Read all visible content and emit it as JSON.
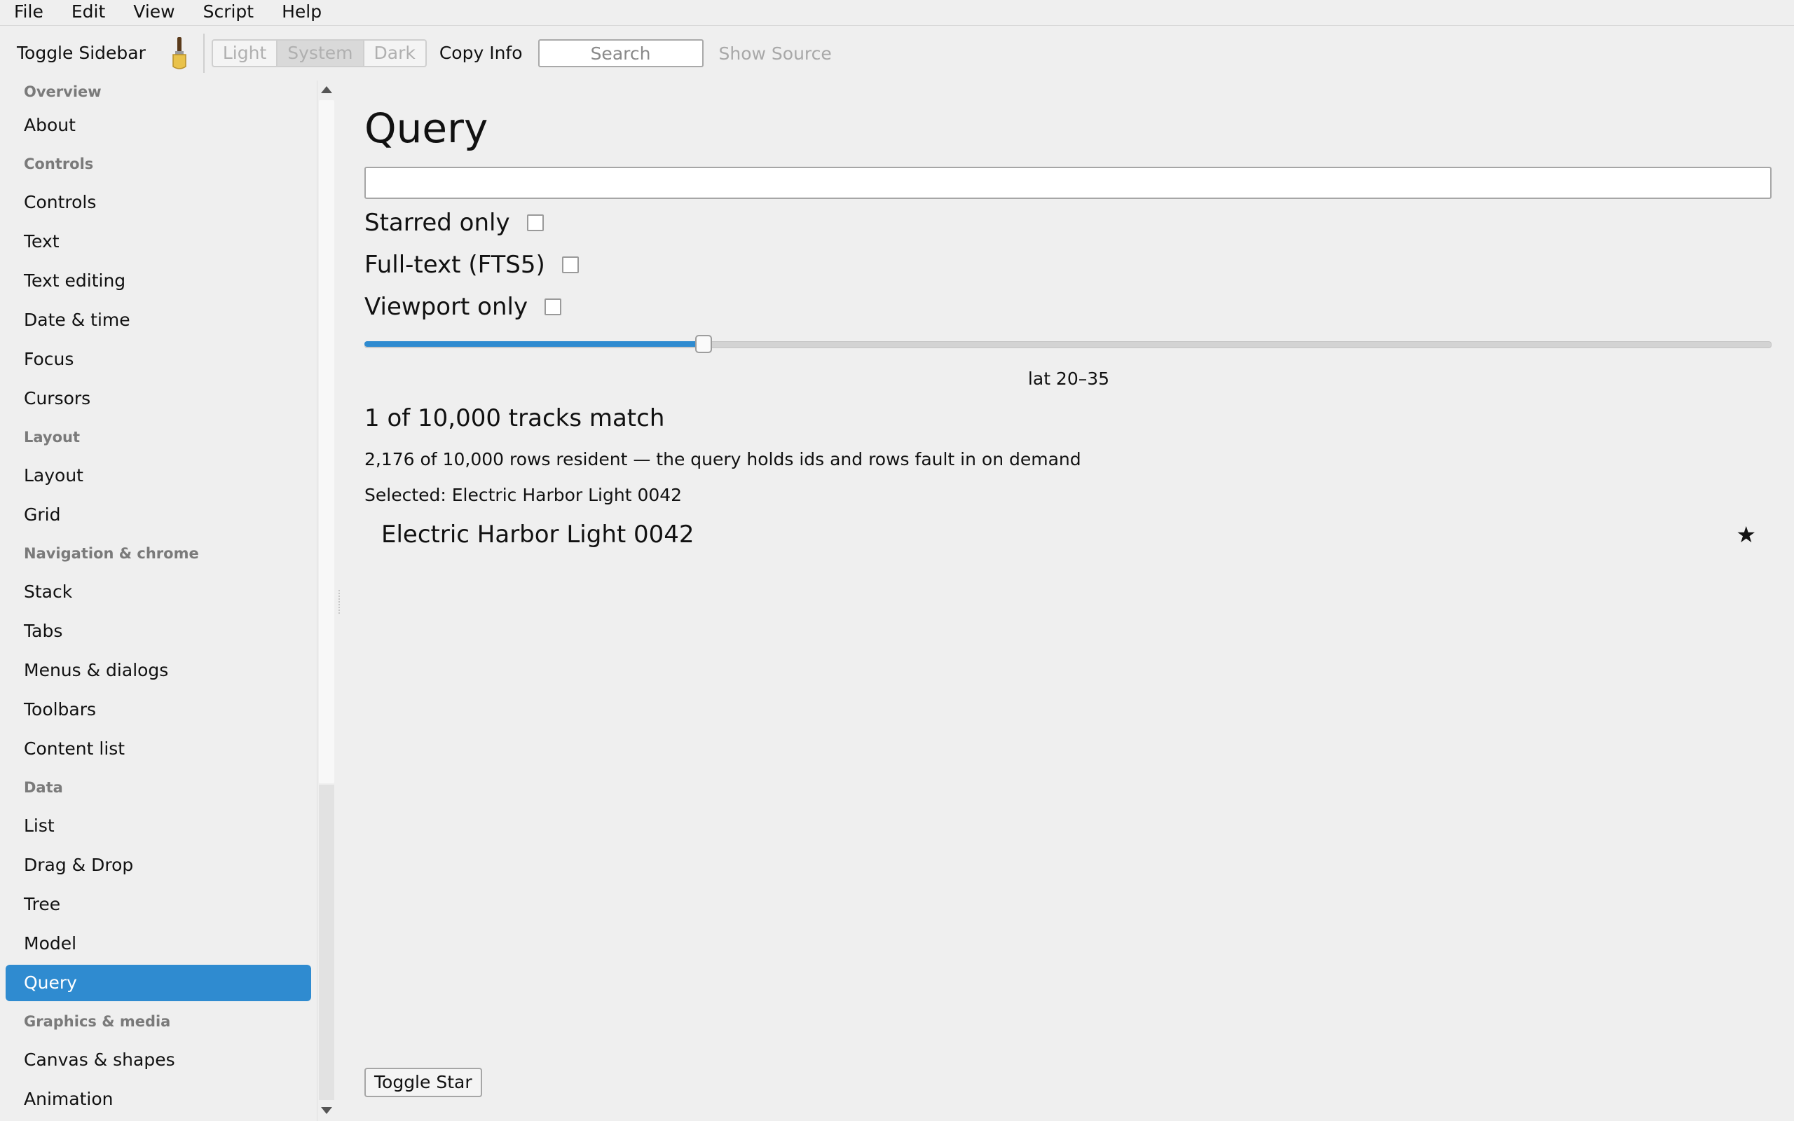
{
  "menu": [
    "File",
    "Edit",
    "View",
    "Script",
    "Help"
  ],
  "toolbar": {
    "toggle_sidebar": "Toggle Sidebar",
    "theme": {
      "light": "Light",
      "system": "System",
      "dark": "Dark",
      "selected": "System"
    },
    "copy_info": "Copy Info",
    "search_placeholder": "Search",
    "show_source": "Show Source"
  },
  "sidebar": {
    "sections": [
      {
        "header": "Overview",
        "items": [
          "About"
        ]
      },
      {
        "header": "Controls",
        "items": [
          "Controls",
          "Text",
          "Text editing",
          "Date & time",
          "Focus",
          "Cursors"
        ]
      },
      {
        "header": "Layout",
        "items": [
          "Layout",
          "Grid"
        ]
      },
      {
        "header": "Navigation & chrome",
        "items": [
          "Stack",
          "Tabs",
          "Menus & dialogs",
          "Toolbars",
          "Content list"
        ]
      },
      {
        "header": "Data",
        "items": [
          "List",
          "Drag & Drop",
          "Tree",
          "Model",
          "Query"
        ]
      },
      {
        "header": "Graphics & media",
        "items": [
          "Canvas & shapes",
          "Animation"
        ]
      }
    ],
    "selected": "Query"
  },
  "main": {
    "title": "Query",
    "query_value": "",
    "filters": [
      {
        "label": "Starred only",
        "checked": false
      },
      {
        "label": "Full-text (FTS5)",
        "checked": false
      },
      {
        "label": "Viewport only",
        "checked": false
      }
    ],
    "slider": {
      "fraction": 0.238,
      "label": "lat 20–35"
    },
    "match_count": "1 of 10,000 tracks match",
    "resident": "2,176 of 10,000 rows resident — the query holds ids and rows fault in on demand",
    "selected": "Selected: Electric Harbor Light 0042",
    "results": [
      {
        "title": "Electric Harbor Light 0042",
        "starred": true,
        "star": "★"
      }
    ],
    "toggle_star": "Toggle Star"
  }
}
